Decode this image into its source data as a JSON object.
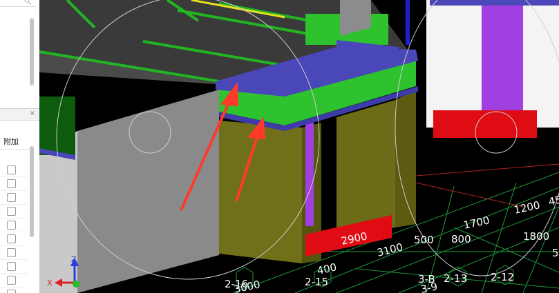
{
  "left_panel": {
    "search_icon": "search-icon",
    "close_icon_glyph": "×",
    "column_header": "附加",
    "checkbox_count": 10
  },
  "viewport": {
    "dimensions": [
      {
        "id": "dim-2900",
        "text": "2900"
      },
      {
        "id": "dim-3100",
        "text": "3100"
      },
      {
        "id": "dim-500",
        "text": "500"
      },
      {
        "id": "dim-800",
        "text": "800"
      },
      {
        "id": "dim-1700",
        "text": "1700"
      },
      {
        "id": "dim-1200",
        "text": "1200"
      },
      {
        "id": "dim-45",
        "text": "45"
      },
      {
        "id": "dim-1800",
        "text": "1800"
      },
      {
        "id": "dim-400",
        "text": "400"
      },
      {
        "id": "dim-3000",
        "text": "3000"
      }
    ],
    "axis_labels": [
      {
        "id": "axis-2-16",
        "text": "2-16"
      },
      {
        "id": "axis-2-15",
        "text": "2-15"
      },
      {
        "id": "axis-3-B",
        "text": "3-B"
      },
      {
        "id": "axis-2-13",
        "text": "2-13"
      },
      {
        "id": "axis-2-12",
        "text": "2-12"
      },
      {
        "id": "axis-3-9",
        "text": "3-9"
      },
      {
        "id": "axis-5",
        "text": "5"
      }
    ],
    "gizmo": {
      "x_label": "X",
      "z_label": "Z"
    },
    "colors": {
      "beam_green": "#2fc22f",
      "cap_blue": "#4a48b8",
      "wall_gray": "#8c8c8c",
      "column_olive": "#70701a",
      "footing_red": "#e00c14",
      "grid_green": "#1f9a3a",
      "arrow_red": "#ff3a2a",
      "purple": "#a040e0"
    }
  }
}
